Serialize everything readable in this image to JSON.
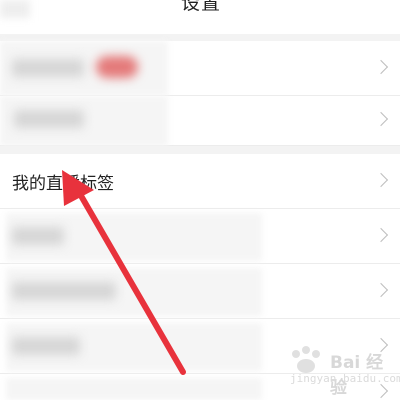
{
  "header": {
    "title": "设置"
  },
  "rows": [
    {
      "label": ""
    },
    {
      "label": ""
    },
    {
      "label": "我的直播标签"
    },
    {
      "label": ""
    },
    {
      "label": ""
    },
    {
      "label": ""
    }
  ],
  "icons": {
    "chevron": "chevron-right-icon"
  },
  "colors": {
    "arrow": "#e8323c",
    "background": "#ffffff",
    "divider": "#ececec"
  },
  "watermark": {
    "text": "Bai 经验",
    "sub": "jingyan.baidu.com"
  }
}
